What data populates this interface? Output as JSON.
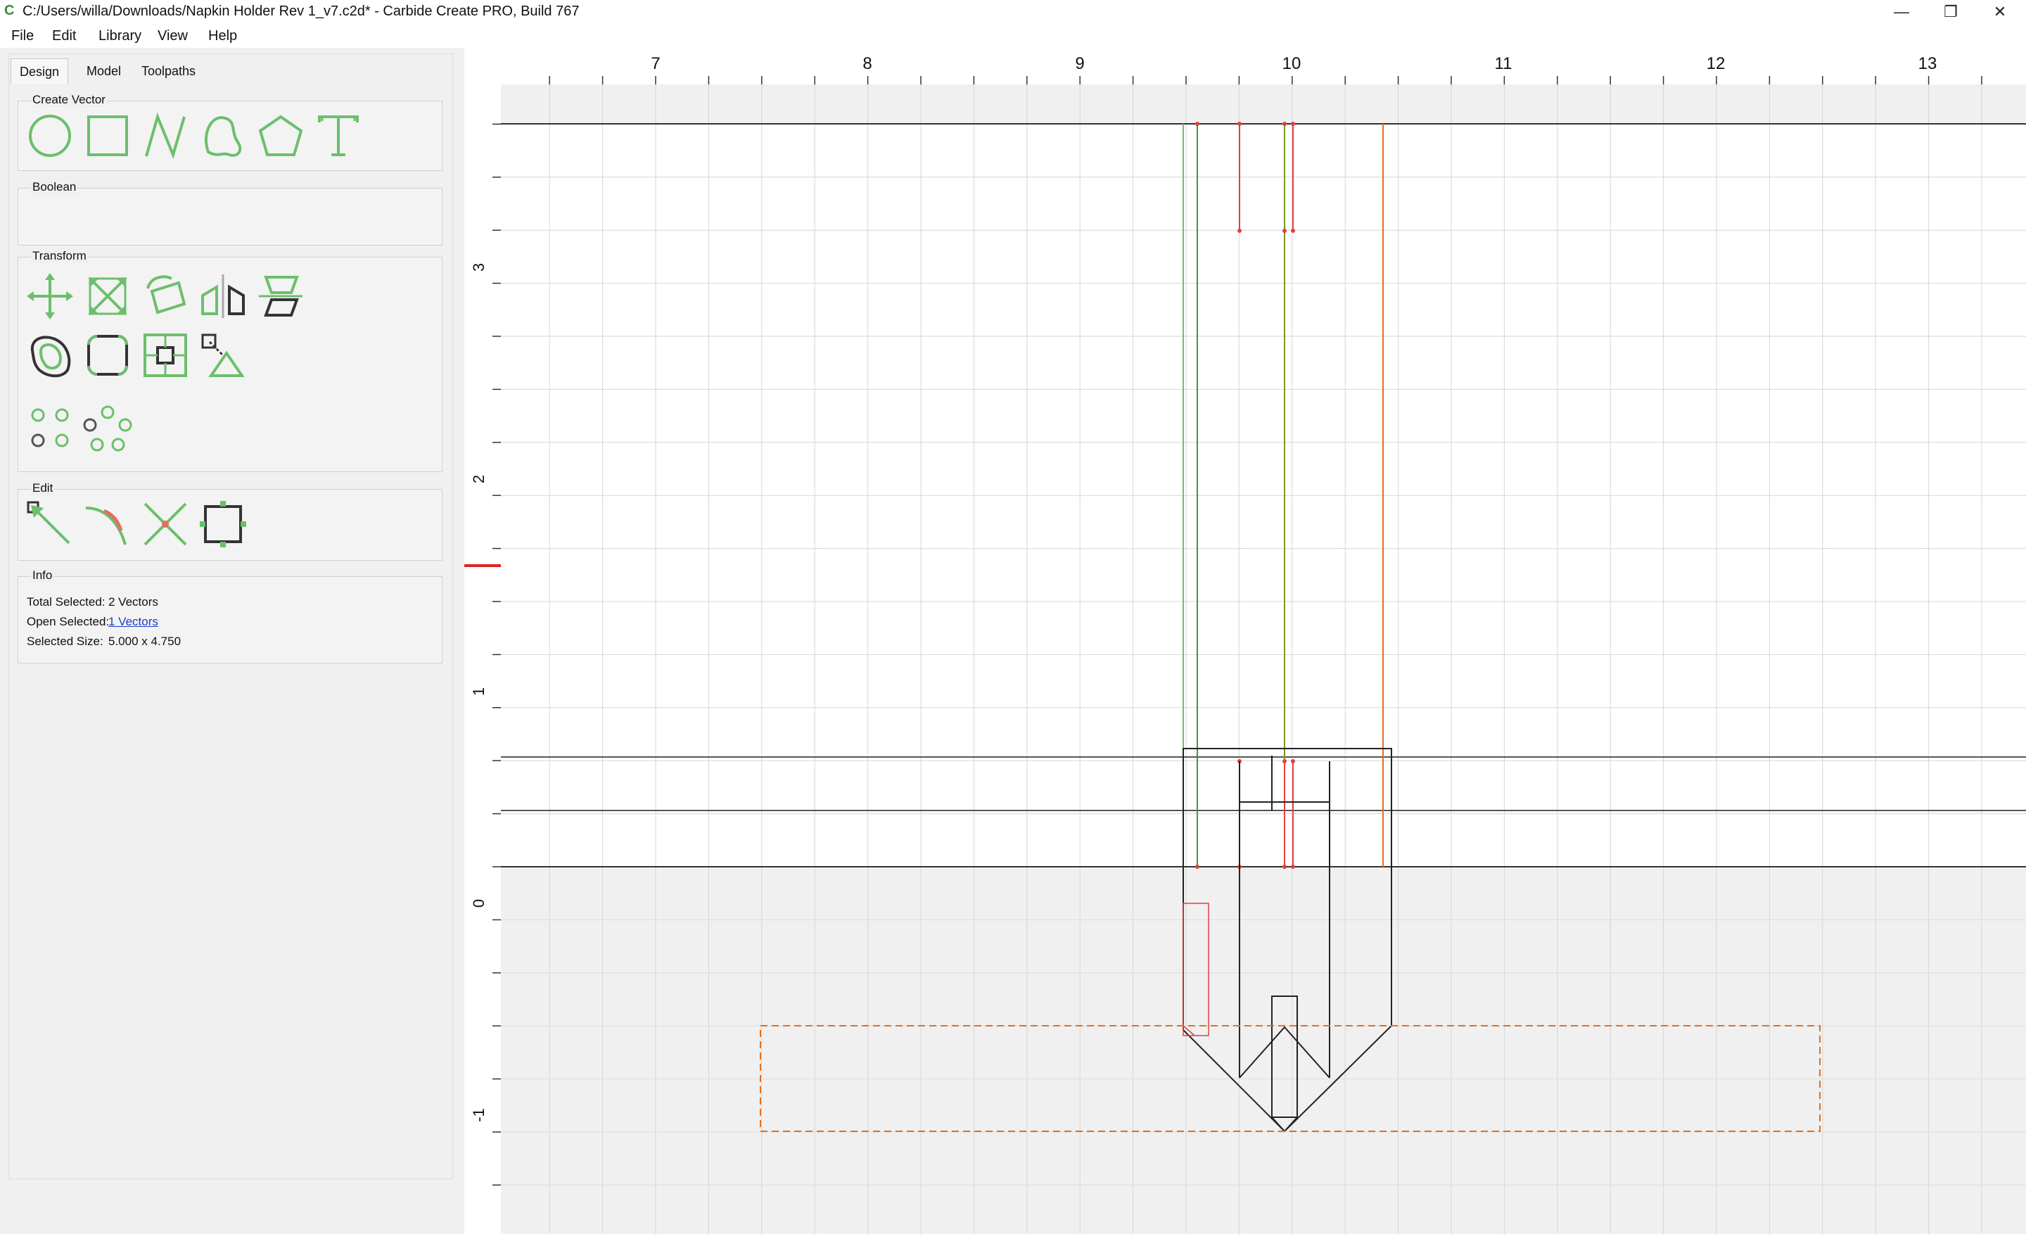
{
  "window": {
    "title": "C:/Users/willa/Downloads/Napkin Holder Rev 1_v7.c2d* - Carbide Create PRO, Build 767",
    "minimize_glyph": "—",
    "maximize_glyph": "❐",
    "close_glyph": "✕"
  },
  "menu": {
    "items": [
      "File",
      "Edit",
      "Library",
      "View",
      "Help"
    ]
  },
  "tabs": [
    "Design",
    "Model",
    "Toolpaths"
  ],
  "groups": {
    "create_vector": "Create Vector",
    "boolean": "Boolean",
    "transform": "Transform",
    "edit": "Edit",
    "info": "Info"
  },
  "icons": {
    "create_vector": [
      "circle-icon",
      "rectangle-icon",
      "polyline-icon",
      "curve-icon",
      "polygon-icon",
      "text-icon"
    ],
    "transform": [
      "move-icon",
      "scale-icon",
      "rotate-icon",
      "mirror-icon",
      "align-icon",
      "offset-icon",
      "fillet-icon",
      "join-icon",
      "nudge-icon",
      "array-grid-icon",
      "array-circular-icon"
    ],
    "edit": [
      "node-edit-icon",
      "trim-curve-icon",
      "cut-icon",
      "bounding-box-icon"
    ]
  },
  "info": {
    "total_selected_label": "Total Selected:",
    "total_selected_value": "2 Vectors",
    "open_selected_label": "Open Selected:",
    "open_selected_value": "1 Vectors",
    "selected_size_label": "Selected Size:",
    "selected_size_value": "5.000 x 4.750"
  },
  "rulers": {
    "x_labels": [
      "7",
      "8",
      "9",
      "10",
      "11",
      "12",
      "13"
    ],
    "y_labels": [
      "3",
      "2",
      "1",
      "0",
      "-1"
    ]
  },
  "colors": {
    "accent_green": "#6cbf6c",
    "selection_orange": "#e07020",
    "toolpath_red": "#e04040",
    "grid": "#d8d8d8",
    "stock_white": "#ffffff"
  }
}
